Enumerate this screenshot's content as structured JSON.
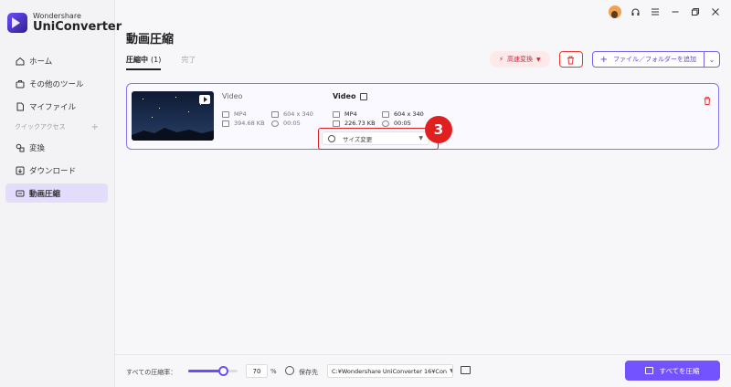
{
  "app": {
    "brand_small": "Wondershare",
    "brand_name": "UniConverter"
  },
  "sidebar": {
    "items": [
      {
        "label": "ホーム",
        "icon": "home-icon"
      },
      {
        "label": "その他のツール",
        "icon": "toolbox-icon"
      },
      {
        "label": "マイファイル",
        "icon": "file-icon"
      }
    ],
    "quick_access_label": "クイックアクセス",
    "quick_items": [
      {
        "label": "変換",
        "icon": "convert-icon"
      },
      {
        "label": "ダウンロード",
        "icon": "download-icon"
      },
      {
        "label": "動画圧縮",
        "icon": "compress-icon",
        "active": true
      }
    ]
  },
  "page": {
    "title": "動画圧縮"
  },
  "tabs": [
    {
      "label": "圧縮中",
      "count": "(1)",
      "active": true
    },
    {
      "label": "完了",
      "active": false
    }
  ],
  "actions": {
    "speed_label": "高速変換",
    "add_label": "ファイル／フォルダーを追加"
  },
  "file": {
    "source": {
      "name": "Video",
      "format": "MP4",
      "resolution": "604 x 340",
      "size": "394.68 KB",
      "duration": "00:05"
    },
    "output": {
      "name": "Video",
      "format": "MP4",
      "resolution": "604 x 340",
      "size": "226.73 KB",
      "duration": "00:05"
    },
    "resize_label": "サイズ変更"
  },
  "annotation": {
    "step": "3",
    "color": "#e02020"
  },
  "bottom": {
    "rate_label": "すべての圧縮率：",
    "rate_value": "70",
    "rate_fraction": 0.7,
    "percent_sign": "%",
    "save_label": "保存先",
    "save_path": "C:¥Wondershare UniConverter 16¥Con",
    "compress_all_label": "すべてを圧縮"
  },
  "colors": {
    "accent": "#7352ff",
    "danger": "#e33333"
  }
}
